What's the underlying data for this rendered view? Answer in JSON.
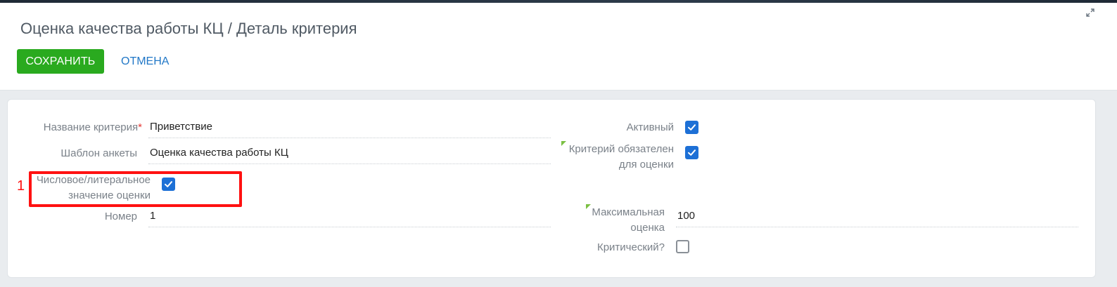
{
  "header": {
    "title": "Оценка качества работы КЦ / Деталь критерия",
    "save_label": "СОХРАНИТЬ",
    "cancel_label": "ОТМЕНА"
  },
  "form": {
    "left": {
      "criterion_name": {
        "label": "Название критерия",
        "required_mark": "*",
        "value": "Приветствие"
      },
      "survey_template": {
        "label": "Шаблон анкеты",
        "value": "Оценка качества работы КЦ"
      },
      "numeric_literal": {
        "label_line1": "Числовое/литеральное",
        "label_line2": "значение оценки",
        "checked": true
      },
      "number": {
        "label": "Номер",
        "value": "1"
      }
    },
    "right": {
      "active": {
        "label": "Активный",
        "checked": true
      },
      "mandatory": {
        "label_line1": "Критерий обязателен",
        "label_line2": "для оценки",
        "checked": true
      },
      "max_score": {
        "label_line1": "Максимальная",
        "label_line2": "оценка",
        "value": "100"
      },
      "critical": {
        "label": "Критический?",
        "checked": false
      }
    }
  },
  "annotation": {
    "marker": "1",
    "color": "#ff1111"
  },
  "colors": {
    "save_button": "#2aaa1f",
    "link": "#2278c7",
    "checkbox": "#1d70d6",
    "required": "#e53935",
    "hint_triangle": "#7bc043"
  },
  "icons": [
    "expand-icon",
    "checkmark-icon"
  ]
}
